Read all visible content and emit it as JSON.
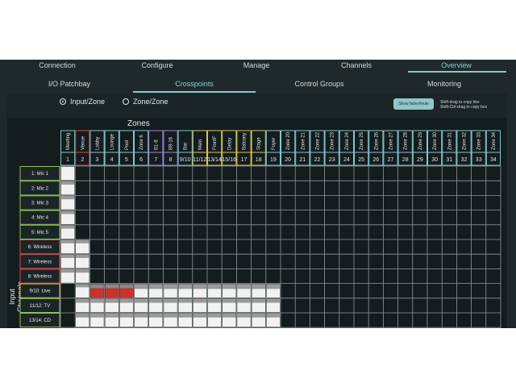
{
  "nav": {
    "top_tabs": [
      {
        "label": "Connection",
        "active": false
      },
      {
        "label": "Configure",
        "active": false
      },
      {
        "label": "Manage",
        "active": false
      },
      {
        "label": "Channels",
        "active": false
      },
      {
        "label": "Overview",
        "active": true
      }
    ],
    "sub_tabs": [
      {
        "label": "I/O Patchbay",
        "active": false
      },
      {
        "label": "Crosspoints",
        "active": true
      },
      {
        "label": "Control Groups",
        "active": false
      },
      {
        "label": "Monitoring",
        "active": false
      }
    ]
  },
  "mode": {
    "options": [
      {
        "label": "Input/Zone",
        "selected": true
      },
      {
        "label": "Zone/Zone",
        "selected": false
      }
    ]
  },
  "toolbar": {
    "show_button_label": "Show fader/mute",
    "hint_line1": "Shift-drag to copy line",
    "hint_line2": "Shift-Ctrl-drag to copy box"
  },
  "grid": {
    "zones_title": "Zones",
    "input_title": "Input Channels",
    "columns": [
      {
        "name": "Meeting",
        "num": "1",
        "color": "#7fc9cf"
      },
      {
        "name": "Venue",
        "num": "2",
        "color": "#d84a4a"
      },
      {
        "name": "Lobby",
        "num": "3",
        "color": "#7fc9cf"
      },
      {
        "name": "Lounge",
        "num": "4",
        "color": "#7fc9cf"
      },
      {
        "name": "Pool",
        "num": "5",
        "color": "#7fc9cf"
      },
      {
        "name": "Zone 6",
        "num": "6",
        "color": "#7fc9cf"
      },
      {
        "name": "B1-8",
        "num": "7",
        "color": "#9a86d6"
      },
      {
        "name": "B9-16",
        "num": "8",
        "color": "#9a86d6"
      },
      {
        "name": "Bar",
        "num": "9/10",
        "color": "#7fc9cf"
      },
      {
        "name": "Main",
        "num": "11/12",
        "color": "#d8c85a"
      },
      {
        "name": "FrontF",
        "num": "13/14",
        "color": "#d8c85a"
      },
      {
        "name": "Delay",
        "num": "15/16",
        "color": "#d8c85a"
      },
      {
        "name": "Balcony",
        "num": "17",
        "color": "#d8c85a"
      },
      {
        "name": "Stage",
        "num": "18",
        "color": "#d8c85a"
      },
      {
        "name": "Foyer",
        "num": "19",
        "color": "#7fc9cf"
      },
      {
        "name": "Zone 20",
        "num": "20",
        "color": "#7fc9cf"
      },
      {
        "name": "Zone 21",
        "num": "21",
        "color": "#7fc9cf"
      },
      {
        "name": "Zone 22",
        "num": "22",
        "color": "#7fc9cf"
      },
      {
        "name": "Zone 23",
        "num": "23",
        "color": "#7fc9cf"
      },
      {
        "name": "Zone 24",
        "num": "24",
        "color": "#7fc9cf"
      },
      {
        "name": "Zone 25",
        "num": "25",
        "color": "#7fc9cf"
      },
      {
        "name": "Zone 26",
        "num": "26",
        "color": "#7fc9cf"
      },
      {
        "name": "Zone 27",
        "num": "27",
        "color": "#7fc9cf"
      },
      {
        "name": "Zone 28",
        "num": "28",
        "color": "#7fc9cf"
      },
      {
        "name": "Zone 29",
        "num": "29",
        "color": "#7fc9cf"
      },
      {
        "name": "Zone 30",
        "num": "30",
        "color": "#7fc9cf"
      },
      {
        "name": "Zone 31",
        "num": "31",
        "color": "#7fc9cf"
      },
      {
        "name": "Zone 32",
        "num": "32",
        "color": "#7fc9cf"
      },
      {
        "name": "Zone 33",
        "num": "33",
        "color": "#7fc9cf"
      },
      {
        "name": "Zone 34",
        "num": "34",
        "color": "#7fc9cf"
      }
    ],
    "rows": [
      {
        "label": "1: Mic 1",
        "color": "#8fbf5a"
      },
      {
        "label": "2: Mic 2",
        "color": "#8fbf5a"
      },
      {
        "label": "3: Mic 3",
        "color": "#8fbf5a"
      },
      {
        "label": "4: Mic 4",
        "color": "#8fbf5a"
      },
      {
        "label": "5: Mic 5",
        "color": "#8fbf5a"
      },
      {
        "label": "6: Wireless",
        "color": "#d84a4a"
      },
      {
        "label": "7: Wireless",
        "color": "#d84a4a"
      },
      {
        "label": "8: Wireless",
        "color": "#d84a4a"
      },
      {
        "label": "9/10: Live",
        "color": "#d8c85a"
      },
      {
        "label": "11/12: TV",
        "color": "#8fbf5a"
      },
      {
        "label": "13/14: CD",
        "color": "#8fbf5a"
      }
    ],
    "cell_colors": {
      "on": "#f2f2f2",
      "muted": "#c8342b",
      "level_hi": "#9a9a9a",
      "level_lo": "#5b5b5b"
    },
    "cells": [
      {
        "row": 0,
        "col": 0,
        "state": "on",
        "level": 1.0
      },
      {
        "row": 1,
        "col": 0,
        "state": "on",
        "level": 0.6
      },
      {
        "row": 2,
        "col": 0,
        "state": "on",
        "level": 0.6
      },
      {
        "row": 3,
        "col": 0,
        "state": "on",
        "level": 0.6
      },
      {
        "row": 4,
        "col": 0,
        "state": "on",
        "level": 0.6
      },
      {
        "row": 5,
        "col": 0,
        "state": "on",
        "level": 0.6
      },
      {
        "row": 5,
        "col": 1,
        "state": "on",
        "level": 0.6
      },
      {
        "row": 6,
        "col": 0,
        "state": "on",
        "level": 0.6
      },
      {
        "row": 6,
        "col": 1,
        "state": "on",
        "level": 0.6
      },
      {
        "row": 7,
        "col": 0,
        "state": "on",
        "level": 0.6
      },
      {
        "row": 7,
        "col": 1,
        "state": "on",
        "level": 0.6
      },
      {
        "row": 8,
        "col": 1,
        "state": "on",
        "level": 0.6
      },
      {
        "row": 8,
        "col": 2,
        "state": "muted",
        "level": 0.5
      },
      {
        "row": 8,
        "col": 3,
        "state": "muted",
        "level": 0.5
      },
      {
        "row": 8,
        "col": 4,
        "state": "muted",
        "level": 0.5
      },
      {
        "row": 8,
        "col": 5,
        "state": "on",
        "level": 0.4
      },
      {
        "row": 8,
        "col": 6,
        "state": "on",
        "level": 0.4
      },
      {
        "row": 8,
        "col": 7,
        "state": "on",
        "level": 0.4
      },
      {
        "row": 8,
        "col": 8,
        "state": "on",
        "level": 0.4
      },
      {
        "row": 8,
        "col": 9,
        "state": "on",
        "level": 0.4
      },
      {
        "row": 8,
        "col": 10,
        "state": "on",
        "level": 0.4
      },
      {
        "row": 8,
        "col": 11,
        "state": "on",
        "level": 0.4
      },
      {
        "row": 8,
        "col": 12,
        "state": "on",
        "level": 0.4
      },
      {
        "row": 8,
        "col": 13,
        "state": "on",
        "level": 0.4
      },
      {
        "row": 8,
        "col": 14,
        "state": "on",
        "level": 0.4
      },
      {
        "row": 9,
        "col": 1,
        "state": "on",
        "level": 0.5
      },
      {
        "row": 9,
        "col": 2,
        "state": "on",
        "level": 0.5
      },
      {
        "row": 9,
        "col": 3,
        "state": "on",
        "level": 0.5
      },
      {
        "row": 9,
        "col": 4,
        "state": "on",
        "level": 0.5
      },
      {
        "row": 9,
        "col": 5,
        "state": "on",
        "level": 0.5
      },
      {
        "row": 9,
        "col": 6,
        "state": "on",
        "level": 0.5
      },
      {
        "row": 9,
        "col": 7,
        "state": "on",
        "level": 0.5
      },
      {
        "row": 9,
        "col": 8,
        "state": "on",
        "level": 0.5
      },
      {
        "row": 9,
        "col": 9,
        "state": "on",
        "level": 0.5
      },
      {
        "row": 9,
        "col": 10,
        "state": "on",
        "level": 0.5
      },
      {
        "row": 9,
        "col": 11,
        "state": "on",
        "level": 0.5
      },
      {
        "row": 9,
        "col": 12,
        "state": "on",
        "level": 0.5
      },
      {
        "row": 9,
        "col": 13,
        "state": "on",
        "level": 0.5
      },
      {
        "row": 9,
        "col": 14,
        "state": "on",
        "level": 0.5
      },
      {
        "row": 10,
        "col": 1,
        "state": "on",
        "level": 0.5
      },
      {
        "row": 10,
        "col": 2,
        "state": "on",
        "level": 0.5
      },
      {
        "row": 10,
        "col": 3,
        "state": "on",
        "level": 0.5
      },
      {
        "row": 10,
        "col": 4,
        "state": "on",
        "level": 0.5
      },
      {
        "row": 10,
        "col": 5,
        "state": "on",
        "level": 0.5
      },
      {
        "row": 10,
        "col": 6,
        "state": "on",
        "level": 0.5
      },
      {
        "row": 10,
        "col": 7,
        "state": "on",
        "level": 0.5
      },
      {
        "row": 10,
        "col": 8,
        "state": "on",
        "level": 0.5
      },
      {
        "row": 10,
        "col": 9,
        "state": "on",
        "level": 0.5
      },
      {
        "row": 10,
        "col": 10,
        "state": "on",
        "level": 0.5
      },
      {
        "row": 10,
        "col": 11,
        "state": "on",
        "level": 0.5
      },
      {
        "row": 10,
        "col": 12,
        "state": "on",
        "level": 0.5
      },
      {
        "row": 10,
        "col": 13,
        "state": "on",
        "level": 0.5
      },
      {
        "row": 10,
        "col": 14,
        "state": "on",
        "level": 0.5
      }
    ]
  }
}
